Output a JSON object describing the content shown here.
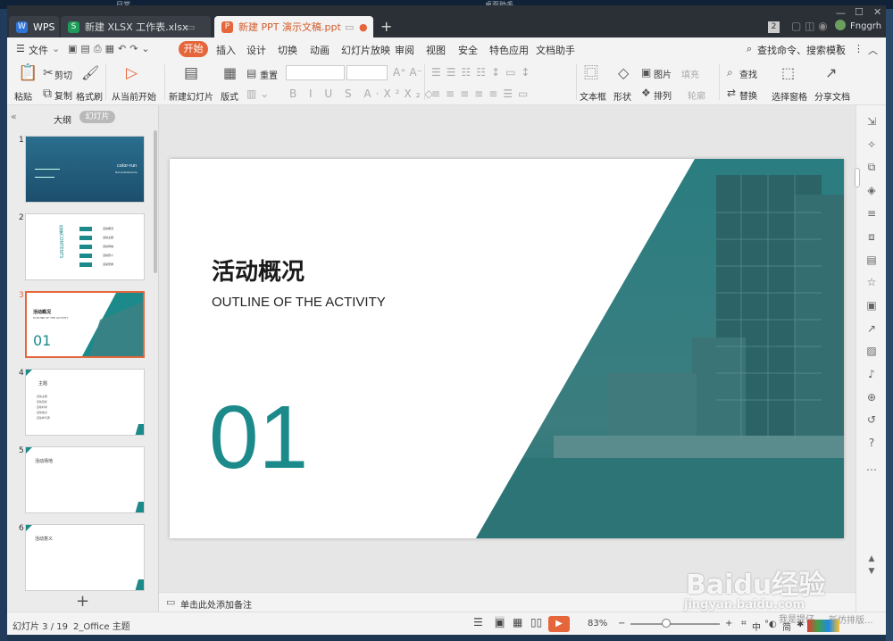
{
  "taskbar": {
    "top_items": [
      "日常",
      "桌面助手"
    ]
  },
  "tabs": {
    "wps": "WPS",
    "xlsx": "新建 XLSX 工作表.xlsx",
    "ppt": "新建 PPT 演示文稿.ppt",
    "new_tab": "+"
  },
  "window": {
    "badge": "2",
    "user": "Fnggrh"
  },
  "menu": {
    "file": "文件",
    "items": [
      "开始",
      "插入",
      "设计",
      "切换",
      "动画",
      "幻灯片放映",
      "审阅",
      "视图",
      "安全",
      "特色应用",
      "文档助手"
    ],
    "search": "查找命令、搜索模板"
  },
  "toolbar": {
    "paste": "粘贴",
    "cut": "剪切",
    "copy": "复制",
    "format_painter": "格式刷",
    "play_from_current": "从当前开始",
    "new_slide": "新建幻灯片",
    "layout": "版式",
    "reset": "重置",
    "text_box": "文本框",
    "shape": "形状",
    "picture": "图片",
    "fill": "填充",
    "arrange": "排列",
    "outline": "轮廓",
    "find": "查找",
    "replace": "替换",
    "select_pane": "选择窗格",
    "share": "分享文档"
  },
  "panel": {
    "outline_tab": "大纲",
    "slides_tab": "幻灯片",
    "add": "+"
  },
  "thumbnails": [
    {
      "num": "1",
      "title": "color-run",
      "subtitle": "Name/Date/Aide"
    },
    {
      "num": "2",
      "title": "目录CONTENTS",
      "items": [
        "活动概况",
        "活动主题",
        "活动场地",
        "活动意义",
        "活动安排"
      ]
    },
    {
      "num": "3",
      "title": "活动概况",
      "subtitle": "OUTLINE OF THE ACTIVITY",
      "number": "01"
    },
    {
      "num": "4",
      "title": "主题",
      "items": [
        "· 活动主题",
        "· 活动目标",
        "· 活动时间",
        "· 活动地点",
        "· 活动参与者"
      ]
    },
    {
      "num": "5",
      "title": "活动场地"
    },
    {
      "num": "6",
      "title": "活动意义"
    }
  ],
  "slide": {
    "title": "活动概况",
    "subtitle": "OUTLINE OF THE ACTIVITY",
    "number": "01",
    "accent": "#1c8a8a"
  },
  "notes_placeholder": "单击此处添加备注",
  "status": {
    "slide_info": "幻灯片 3 / 19",
    "theme": "2_Office 主题",
    "zoom": "83%",
    "ime": "中",
    "ime2": "简",
    "right_text": "我是提仔",
    "right_text2": "新仿排版..."
  },
  "watermark": {
    "brand": "Baidu经验",
    "url": "jingyan.baidu.com"
  }
}
